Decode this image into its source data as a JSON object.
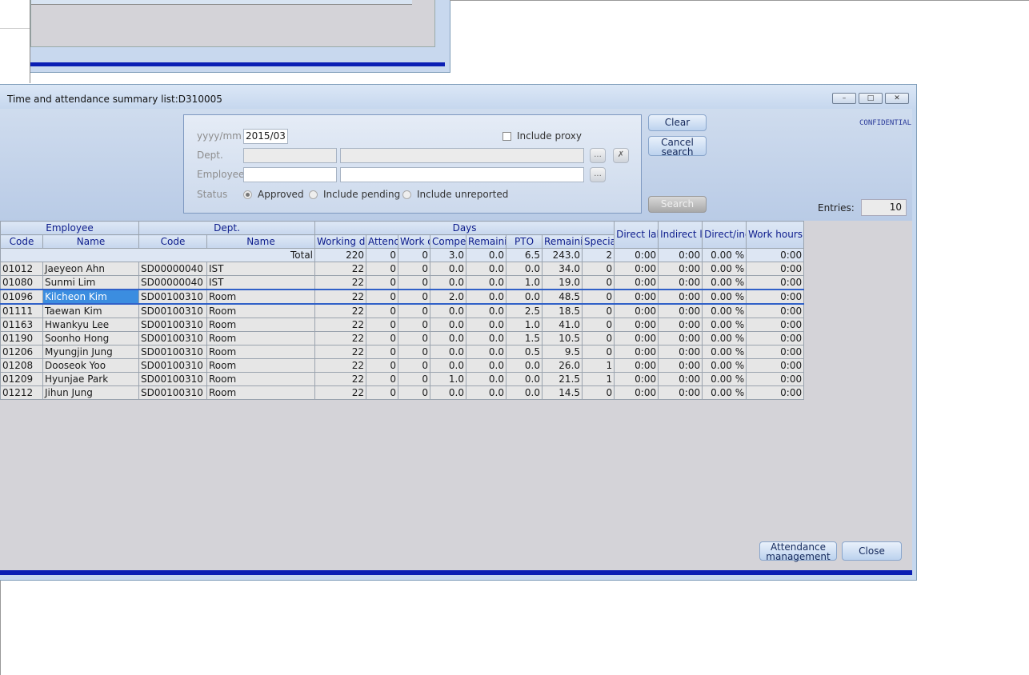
{
  "window": {
    "title": "Time and attendance summary list:D310005",
    "confidential": "CONFIDENTIAL"
  },
  "search": {
    "month_label": "yyyy/mm",
    "month_value": "2015/03",
    "dept_label": "Dept.",
    "employee_label": "Employee",
    "status_label": "Status",
    "include_proxy": "Include proxy",
    "status_options": [
      "Approved",
      "Include pending",
      "Include unreported"
    ],
    "browse_label": "...",
    "clear_field_label": "✗"
  },
  "buttons": {
    "clear": "Clear",
    "cancel_search_1": "Cancel",
    "cancel_search_2": "search",
    "search": "Search",
    "attendance_management_1": "Attendance",
    "attendance_management_2": "management",
    "close": "Close"
  },
  "entries": {
    "label": "Entries:",
    "value": "10"
  },
  "grid": {
    "group_headers": {
      "employee": "Employee",
      "dept": "Dept.",
      "days": "Days"
    },
    "headers": {
      "emp_code": "Code",
      "emp_name": "Name",
      "dept_code": "Code",
      "dept_name": "Name",
      "working_days": "Working days",
      "attend": "Attendance",
      "work_off": "Work off",
      "comper": "Compensatory",
      "remaining1": "Remaining",
      "pto": "PTO",
      "remaining2": "Remaining",
      "special": "Special",
      "direct_labor": "Direct labor",
      "indirect_labor": "Indirect labor",
      "direct_indirect": "Direct/indirect",
      "work_hours": "Work hours total"
    },
    "total": {
      "label": "Total",
      "values": [
        "220",
        "0",
        "0",
        "3.0",
        "0.0",
        "6.5",
        "243.0",
        "2",
        "0:00",
        "0:00",
        "0.00 %",
        "0:00"
      ]
    },
    "rows": [
      {
        "code": "01012",
        "name": "Jaeyeon Ahn",
        "dcode": "SD00000040",
        "dname": "IST",
        "v": [
          "22",
          "0",
          "0",
          "0.0",
          "0.0",
          "0.0",
          "34.0",
          "0",
          "0:00",
          "0:00",
          "0.00 %",
          "0:00"
        ]
      },
      {
        "code": "01080",
        "name": "Sunmi Lim",
        "dcode": "SD00000040",
        "dname": "IST",
        "v": [
          "22",
          "0",
          "0",
          "0.0",
          "0.0",
          "1.0",
          "19.0",
          "0",
          "0:00",
          "0:00",
          "0.00 %",
          "0:00"
        ]
      },
      {
        "code": "01096",
        "name": "Kilcheon Kim",
        "dcode": "SD00100310",
        "dname": "Room",
        "v": [
          "22",
          "0",
          "0",
          "2.0",
          "0.0",
          "0.0",
          "48.5",
          "0",
          "0:00",
          "0:00",
          "0.00 %",
          "0:00"
        ]
      },
      {
        "code": "01111",
        "name": "Taewan Kim",
        "dcode": "SD00100310",
        "dname": "Room",
        "v": [
          "22",
          "0",
          "0",
          "0.0",
          "0.0",
          "2.5",
          "18.5",
          "0",
          "0:00",
          "0:00",
          "0.00 %",
          "0:00"
        ]
      },
      {
        "code": "01163",
        "name": "Hwankyu Lee",
        "dcode": "SD00100310",
        "dname": "Room",
        "v": [
          "22",
          "0",
          "0",
          "0.0",
          "0.0",
          "1.0",
          "41.0",
          "0",
          "0:00",
          "0:00",
          "0.00 %",
          "0:00"
        ]
      },
      {
        "code": "01190",
        "name": "Soonho Hong",
        "dcode": "SD00100310",
        "dname": "Room",
        "v": [
          "22",
          "0",
          "0",
          "0.0",
          "0.0",
          "1.5",
          "10.5",
          "0",
          "0:00",
          "0:00",
          "0.00 %",
          "0:00"
        ]
      },
      {
        "code": "01206",
        "name": "Myungjin Jung",
        "dcode": "SD00100310",
        "dname": "Room",
        "v": [
          "22",
          "0",
          "0",
          "0.0",
          "0.0",
          "0.5",
          "9.5",
          "0",
          "0:00",
          "0:00",
          "0.00 %",
          "0:00"
        ]
      },
      {
        "code": "01208",
        "name": "Dooseok Yoo",
        "dcode": "SD00100310",
        "dname": "Room",
        "v": [
          "22",
          "0",
          "0",
          "0.0",
          "0.0",
          "0.0",
          "26.0",
          "1",
          "0:00",
          "0:00",
          "0.00 %",
          "0:00"
        ]
      },
      {
        "code": "01209",
        "name": "Hyunjae Park",
        "dcode": "SD00100310",
        "dname": "Room",
        "v": [
          "22",
          "0",
          "0",
          "1.0",
          "0.0",
          "0.0",
          "21.5",
          "1",
          "0:00",
          "0:00",
          "0.00 %",
          "0:00"
        ]
      },
      {
        "code": "01212",
        "name": "Jihun Jung",
        "dcode": "SD00100310",
        "dname": "Room",
        "v": [
          "22",
          "0",
          "0",
          "0.0",
          "0.0",
          "0.0",
          "14.5",
          "0",
          "0:00",
          "0:00",
          "0.00 %",
          "0:00"
        ]
      }
    ],
    "selected_row_index": 2
  }
}
